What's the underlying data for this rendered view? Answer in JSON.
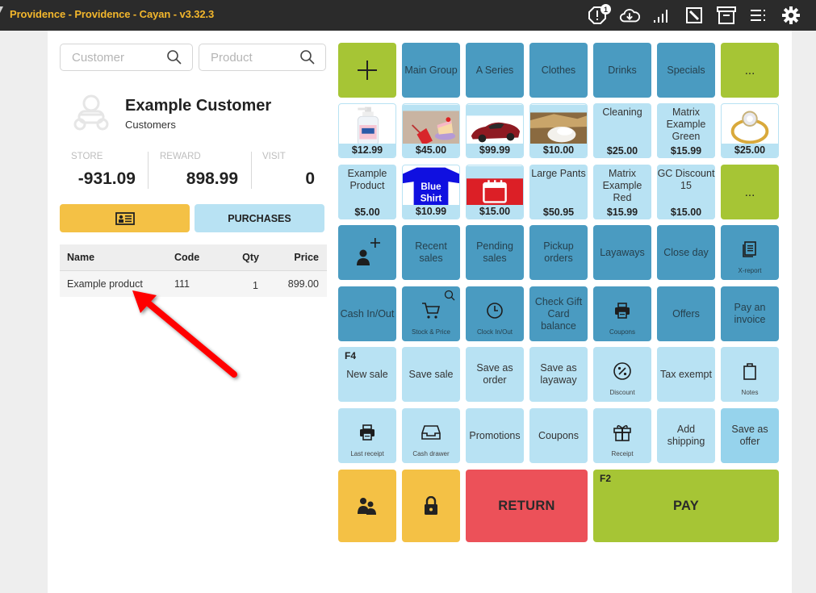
{
  "window": {
    "title": "Providence - Providence - Cayan - v3.32.3",
    "alert_count": "1",
    "toolbar_icons": [
      "alert-icon",
      "cloud-sync-icon",
      "signal-icon",
      "edit-icon",
      "archive-icon",
      "menu-icon",
      "settings-icon"
    ]
  },
  "search": {
    "customer_placeholder": "Customer",
    "product_placeholder": "Product"
  },
  "customer": {
    "name": "Example Customer",
    "group": "Customers",
    "stats": [
      {
        "label": "STORE",
        "value": "-931.09"
      },
      {
        "label": "REWARD",
        "value": "898.99"
      },
      {
        "label": "VISIT",
        "value": "0"
      }
    ],
    "purchases_label": "PURCHASES"
  },
  "cart": {
    "columns": [
      "Name",
      "Code",
      "Qty",
      "Price"
    ],
    "rows": [
      {
        "name": "Example product",
        "code": "111",
        "qty": "1",
        "price": "899.00"
      }
    ]
  },
  "categories": {
    "items": [
      "Main Group",
      "A Series",
      "Clothes",
      "Drinks",
      "Specials"
    ],
    "more_label": "..."
  },
  "products": {
    "row1": [
      {
        "name": "Hand sanitizer",
        "price": "$12.99",
        "image": "sanitizer"
      },
      {
        "name": "Drink and cake",
        "price": "$45.00",
        "image": "cake"
      },
      {
        "name": "Red car",
        "price": "$99.99",
        "image": "car"
      },
      {
        "name": "Flour",
        "price": "$10.00",
        "image": "flour"
      },
      {
        "name": "Cleaning",
        "price": "$25.00"
      },
      {
        "name": "Matrix Example Green",
        "price": "$15.99"
      },
      {
        "name": "Ring",
        "price": "$25.00",
        "image": "ring"
      }
    ],
    "row2": [
      {
        "name": "Example Product",
        "price": "$5.00"
      },
      {
        "name": "Blue Shirt",
        "price": "$10.99",
        "image": "shirt"
      },
      {
        "name": "Calendar",
        "price": "$15.00",
        "image": "calendar"
      },
      {
        "name": "Large Pants",
        "price": "$50.95"
      },
      {
        "name": "Matrix Example Red",
        "price": "$15.99"
      },
      {
        "name": "GC Discount 15",
        "price": "$15.00"
      }
    ],
    "more_label": "...",
    "shirt_text": "Blue Shirt"
  },
  "functions": {
    "row1": {
      "recent_sales": "Recent sales",
      "pending_sales": "Pending sales",
      "pickup_orders": "Pickup orders",
      "layaways": "Layaways",
      "close_day": "Close day",
      "x_report": "X-report"
    },
    "row2": {
      "cash_in_out": "Cash In/Out",
      "stock_price": "Stock & Price",
      "clock_in_out": "Clock In/Out",
      "check_gift_card": "Check Gift Card balance",
      "coupons": "Coupons",
      "offers": "Offers",
      "pay_invoice": "Pay an invoice"
    },
    "row3": {
      "new_sale_key": "F4",
      "new_sale": "New sale",
      "save_sale": "Save sale",
      "save_order": "Save as order",
      "save_layaway": "Save as layaway",
      "discount": "Discount",
      "tax_exempt": "Tax exempt",
      "notes": "Notes"
    },
    "row4": {
      "last_receipt": "Last receipt",
      "cash_drawer": "Cash drawer",
      "promotions": "Promotions",
      "coupons": "Coupons",
      "gift_receipt": "Receipt",
      "add_shipping": "Add shipping",
      "save_offer": "Save as offer"
    },
    "bottom": {
      "return": "RETURN",
      "pay_key": "F2",
      "pay": "PAY"
    }
  },
  "colors": {
    "title_accent": "#f3b72c",
    "tile_dark": "#4a9bc1",
    "tile_light": "#b8e2f3",
    "tile_green": "#a6c535",
    "tile_yellow": "#f4c145",
    "tile_red": "#ec5159"
  }
}
